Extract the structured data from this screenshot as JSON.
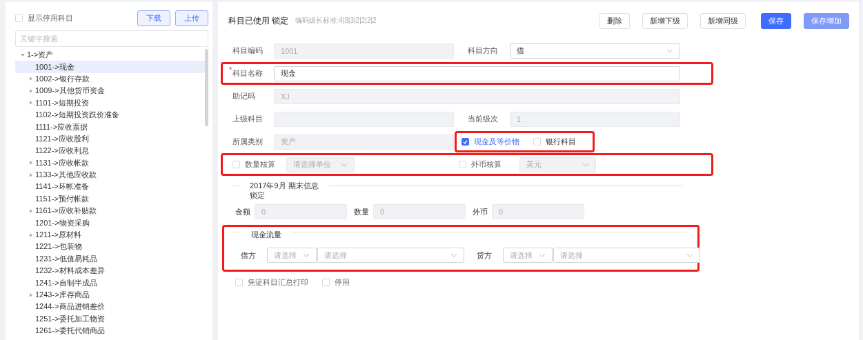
{
  "sidebar": {
    "show_disabled": {
      "label": "显示停用科目",
      "checked": false
    },
    "buttons": [
      {
        "label": "下载"
      },
      {
        "label": "上传"
      }
    ],
    "search": {
      "placeholder": "关键字搜索"
    },
    "tree": [
      {
        "label": "1->资产",
        "expandable": true,
        "expanded": true,
        "selected": false,
        "children": [
          {
            "label": "1001->现金",
            "expandable": false,
            "selected": true
          },
          {
            "label": "1002->银行存款",
            "expandable": true,
            "expanded": false,
            "selected": false
          },
          {
            "label": "1009->其他货币资金",
            "expandable": true,
            "expanded": false,
            "selected": false
          },
          {
            "label": "1101->短期投资",
            "expandable": true,
            "expanded": false,
            "selected": false
          },
          {
            "label": "1102->短期投资跌价准备",
            "expandable": false,
            "selected": false
          },
          {
            "label": "1111->应收票据",
            "expandable": false,
            "selected": false
          },
          {
            "label": "1121->应收股利",
            "expandable": false,
            "selected": false
          },
          {
            "label": "1122->应收利息",
            "expandable": false,
            "selected": false
          },
          {
            "label": "1131->应收帐款",
            "expandable": true,
            "expanded": false,
            "selected": false
          },
          {
            "label": "1133->其他应收款",
            "expandable": true,
            "expanded": false,
            "selected": false
          },
          {
            "label": "1141->坏帐准备",
            "expandable": false,
            "selected": false
          },
          {
            "label": "1151->预付帐款",
            "expandable": false,
            "selected": false
          },
          {
            "label": "1161->应收补贴款",
            "expandable": true,
            "expanded": false,
            "selected": false
          },
          {
            "label": "1201->物资采购",
            "expandable": false,
            "selected": false
          },
          {
            "label": "1211->原材料",
            "expandable": true,
            "expanded": false,
            "selected": false
          },
          {
            "label": "1221->包装物",
            "expandable": false,
            "selected": false
          },
          {
            "label": "1231->低值易耗品",
            "expandable": false,
            "selected": false
          },
          {
            "label": "1232->材料成本差异",
            "expandable": false,
            "selected": false
          },
          {
            "label": "1241->自制半成品",
            "expandable": false,
            "selected": false
          },
          {
            "label": "1243->库存商品",
            "expandable": true,
            "expanded": false,
            "selected": false
          },
          {
            "label": "1244->商品进销差价",
            "expandable": false,
            "selected": false
          },
          {
            "label": "1251->委托加工物资",
            "expandable": false,
            "selected": false
          },
          {
            "label": "1261->委托代销商品",
            "expandable": false,
            "selected": false
          }
        ]
      }
    ]
  },
  "header": {
    "title": "科目已使用 锁定",
    "subtitle": "编码级长标准:4|3|3|2|2|2|2",
    "buttons": [
      {
        "label": "删除",
        "kind": "default",
        "disabled": false
      },
      {
        "label": "新增下级",
        "kind": "default",
        "disabled": false
      },
      {
        "label": "新增同级",
        "kind": "default",
        "disabled": false
      },
      {
        "label": "保存",
        "kind": "primary",
        "disabled": false
      },
      {
        "label": "保存增加",
        "kind": "primary",
        "disabled": true
      }
    ]
  },
  "form": {
    "rows": [
      {
        "highlighted": false,
        "fields": [
          {
            "kind": "input",
            "label": "科目编码",
            "value": "1001",
            "disabled": true
          },
          {
            "kind": "select",
            "label": "科目方向",
            "value": "借",
            "disabled": false
          }
        ]
      },
      {
        "highlighted": true,
        "fields": [
          {
            "kind": "input",
            "label": "科目名称",
            "value": "现金",
            "disabled": false,
            "required_mark": "*"
          }
        ]
      },
      {
        "highlighted": false,
        "fields": [
          {
            "kind": "input",
            "label": "助记码",
            "value": "XJ",
            "disabled": true
          }
        ]
      },
      {
        "highlighted": false,
        "fields": [
          {
            "kind": "input",
            "label": "上级科目",
            "disabled": true
          },
          {
            "kind": "input",
            "label": "当前级次",
            "value": "1",
            "disabled": true
          }
        ]
      },
      {
        "highlighted": false,
        "fields": [
          {
            "kind": "input",
            "label": "所属类别",
            "value": "资产",
            "disabled": true
          },
          {
            "kind": "checks",
            "highlighted": true,
            "items": [
              {
                "label": "现金及等价物",
                "checked": true
              },
              {
                "label": "银行科目",
                "checked": false
              }
            ]
          }
        ]
      },
      {
        "highlighted": true,
        "fields": [
          {
            "kind": "check_select",
            "label": "数量核算",
            "checked": false,
            "placeholder": "请选择单位",
            "disabled": true
          },
          {
            "kind": "check_select",
            "label": "外币核算",
            "checked": false,
            "value": "美元",
            "disabled": true
          }
        ]
      }
    ]
  },
  "period": {
    "legend": "2017年9月 期末信息",
    "note": "锁定",
    "fields": [
      {
        "label": "金额",
        "value": "0"
      },
      {
        "label": "数量",
        "value": "0"
      },
      {
        "label": "外币",
        "value": "0"
      }
    ]
  },
  "cash_flow": {
    "legend": "现金流量",
    "highlighted": true,
    "sides": [
      {
        "label": "借方",
        "category": {
          "placeholder": "请选择"
        },
        "item": {
          "placeholder": "请选择"
        }
      },
      {
        "label": "贷方",
        "category": {
          "placeholder": "请选择"
        },
        "item": {
          "placeholder": "请选择"
        }
      }
    ]
  },
  "footer_checks": [
    {
      "label": "凭证科目汇总打印",
      "checked": false
    },
    {
      "label": "停用",
      "checked": false
    }
  ]
}
